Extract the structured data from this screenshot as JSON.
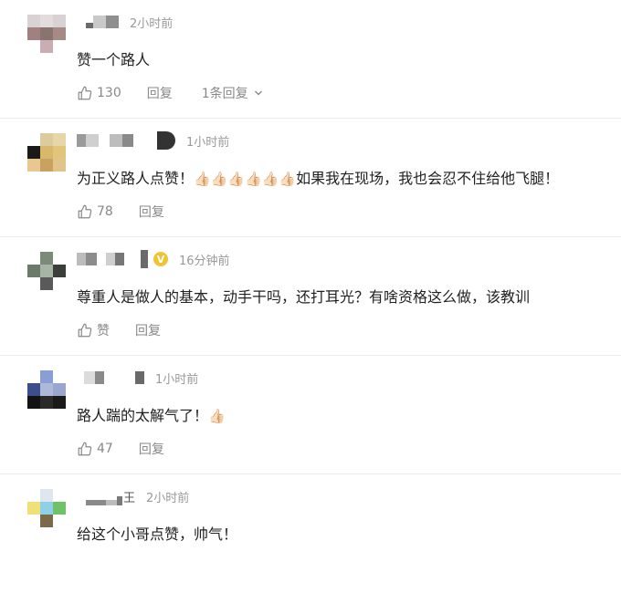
{
  "comments": [
    {
      "time": "2小时前",
      "text": "赞一个路人",
      "likes": "130",
      "reply_label": "回复",
      "reply_count_label": "1条回复"
    },
    {
      "time": "1小时前",
      "text": "为正义路人点赞！",
      "emoji": "👍🏻👍🏻👍🏻👍🏻👍🏻👍🏻",
      "text_after": "如果我在现场，我也会忍不住给他飞腿！",
      "likes": "78",
      "reply_label": "回复"
    },
    {
      "time": "16分钟前",
      "badge": "V",
      "text": "尊重人是做人的基本，动手干吗，还打耳光？有啥资格这么做，该教训",
      "likes": "赞",
      "reply_label": "回复"
    },
    {
      "time": "1小时前",
      "text": "路人踹的太解气了！",
      "emoji": "👍🏻",
      "likes": "47",
      "reply_label": "回复"
    },
    {
      "time": "2小时前",
      "name_suffix": "王",
      "text": "给这个小哥点赞，帅气！"
    }
  ],
  "colors": {
    "text": "#222222",
    "meta": "#999999",
    "action": "#888888",
    "divider": "#ebebeb",
    "badge": "#f2c230"
  },
  "icons": [
    "thumbs-up-icon",
    "chevron-down-icon",
    "verified-badge-icon"
  ]
}
